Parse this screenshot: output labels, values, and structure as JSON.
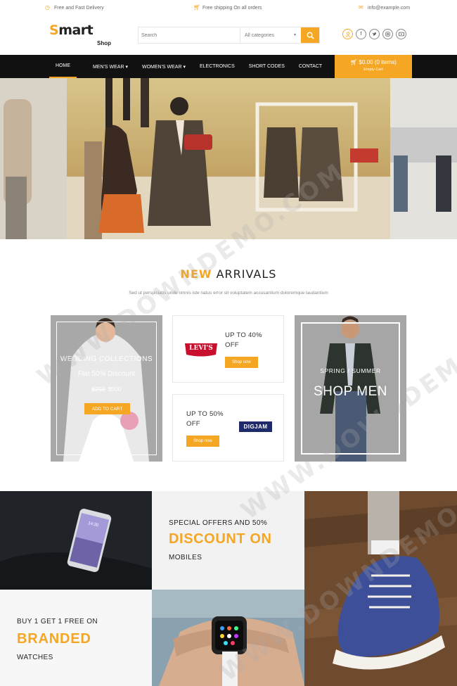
{
  "topbar": {
    "delivery": "Free and Fast Delivery",
    "shipping": "Free shipping On all orders",
    "email": "info@example.com"
  },
  "header": {
    "logo_main": "mart",
    "logo_s": "S",
    "logo_sub": "Shop",
    "search_placeholder": "Search",
    "category_select": "All categories"
  },
  "nav": {
    "items": [
      {
        "label": "HOME"
      },
      {
        "label": "MEN'S WEAR ▾"
      },
      {
        "label": "WOMEN'S WEAR ▾"
      },
      {
        "label": "ELECTRONICS"
      },
      {
        "label": "SHORT CODES"
      },
      {
        "label": "CONTACT"
      }
    ],
    "cart_amount": "$0.00 (0 items)",
    "cart_empty": "Empty Cart"
  },
  "arrivals": {
    "title_highlight": "NEW",
    "title_rest": "ARRIVALS",
    "subtitle": "Sed ut perspiciatis unde omnis iste natus error sit voluptatem accusantium doloremque laudantium"
  },
  "wedding": {
    "title": "WEDDING COLLECTIONS",
    "discount": "Flat 50% Discount",
    "old_price": "$250",
    "new_price": "$500",
    "button": "ADD TO CART"
  },
  "levis": {
    "line1": "UP TO 40%",
    "line2": "OFF",
    "button": "Shop now",
    "brand": "LEVI'S"
  },
  "digjam": {
    "line1": "UP TO 50%",
    "line2": "OFF",
    "button": "Shop now",
    "brand": "DIGJAM"
  },
  "men": {
    "season": "SPRING / SUMMER",
    "title": "SHOP MEN"
  },
  "offers": {
    "mobile_l1": "SPECIAL OFFERS AND 50%",
    "mobile_l2": "DISCOUNT ON",
    "mobile_l3": "MOBILES",
    "watch_l1": "BUY 1 GET 1 FREE ON",
    "watch_l2": "BRANDED",
    "watch_l3": "WATCHES"
  },
  "phone_time": "14:30",
  "colors": {
    "accent": "#f5a623",
    "nav_bg": "#111111"
  },
  "watermark": "WWW.DOWNDEMO.COM"
}
